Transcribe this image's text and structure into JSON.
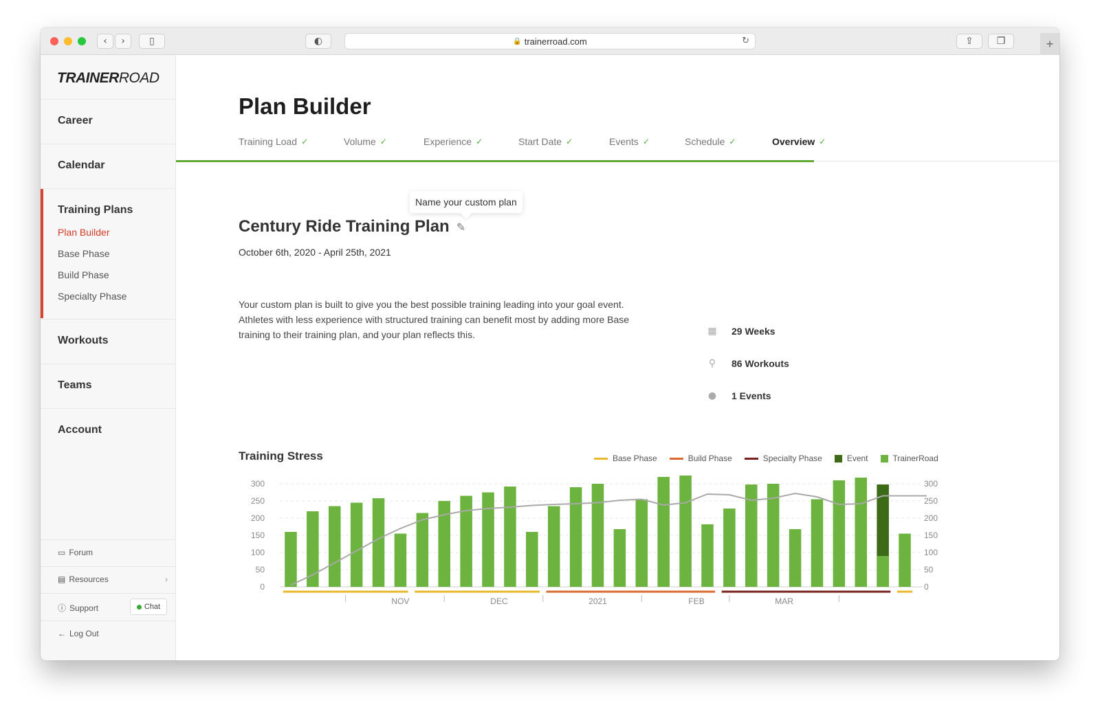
{
  "browser": {
    "url": "trainerroad.com"
  },
  "sidebar": {
    "logo_bold": "TRAINER",
    "logo_light": "ROAD",
    "nav": {
      "career": "Career",
      "calendar": "Calendar",
      "training_plans": "Training Plans",
      "workouts": "Workouts",
      "teams": "Teams",
      "account": "Account"
    },
    "sub": {
      "plan_builder": "Plan Builder",
      "base_phase": "Base Phase",
      "build_phase": "Build Phase",
      "specialty_phase": "Specialty Phase"
    },
    "footer": {
      "forum": "Forum",
      "resources": "Resources",
      "support": "Support",
      "chat": "Chat",
      "logout": "Log Out"
    }
  },
  "main": {
    "title": "Plan Builder",
    "tabs": [
      {
        "label": "Training Load"
      },
      {
        "label": "Volume"
      },
      {
        "label": "Experience"
      },
      {
        "label": "Start Date"
      },
      {
        "label": "Events"
      },
      {
        "label": "Schedule"
      },
      {
        "label": "Overview"
      }
    ],
    "tooltip": "Name your custom plan",
    "plan_name": "Century Ride Training Plan",
    "plan_dates": "October 6th, 2020 - April 25th, 2021",
    "description": "Your custom plan is built to give you the best possible training leading into your goal event. Athletes with less experience with structured training can benefit most by adding more Base training to their training plan, and your plan reflects this.",
    "stats": {
      "weeks": "29 Weeks",
      "workouts": "86 Workouts",
      "events": "1 Events"
    }
  },
  "chart_data": {
    "type": "bar",
    "title": "Training Stress",
    "legend": [
      {
        "name": "Base Phase",
        "color": "#e8b92d",
        "kind": "line"
      },
      {
        "name": "Build Phase",
        "color": "#d9692e",
        "kind": "line"
      },
      {
        "name": "Specialty Phase",
        "color": "#7a1f1f",
        "kind": "line"
      },
      {
        "name": "Event",
        "color": "#3c6a16",
        "kind": "box"
      },
      {
        "name": "TrainerRoad",
        "color": "#6db33f",
        "kind": "box"
      }
    ],
    "ylim": [
      0,
      300
    ],
    "yticks": [
      0,
      50,
      100,
      150,
      200,
      250,
      300
    ],
    "month_labels": [
      "NOV",
      "DEC",
      "2021",
      "FEB",
      "MAR"
    ],
    "values": [
      160,
      220,
      235,
      245,
      258,
      155,
      215,
      250,
      265,
      275,
      292,
      160,
      235,
      290,
      300,
      168,
      255,
      320,
      330,
      182,
      228,
      298,
      300,
      168,
      255,
      310,
      318,
      90,
      155
    ],
    "event_week_index": 27,
    "event_value": 298,
    "trend": [
      5,
      35,
      70,
      105,
      140,
      170,
      195,
      210,
      222,
      228,
      232,
      237,
      240,
      242,
      245,
      252,
      255,
      238,
      245,
      270,
      268,
      252,
      258,
      272,
      262,
      240,
      242,
      265,
      265,
      265
    ],
    "phases": [
      {
        "name": "Base Phase",
        "from": 0,
        "to": 5
      },
      {
        "name": "Base Phase",
        "from": 6,
        "to": 11
      },
      {
        "name": "Build Phase",
        "from": 12,
        "to": 19
      },
      {
        "name": "Specialty Phase",
        "from": 20,
        "to": 27
      },
      {
        "name": "Base Phase",
        "from": 28,
        "to": 28
      }
    ]
  }
}
